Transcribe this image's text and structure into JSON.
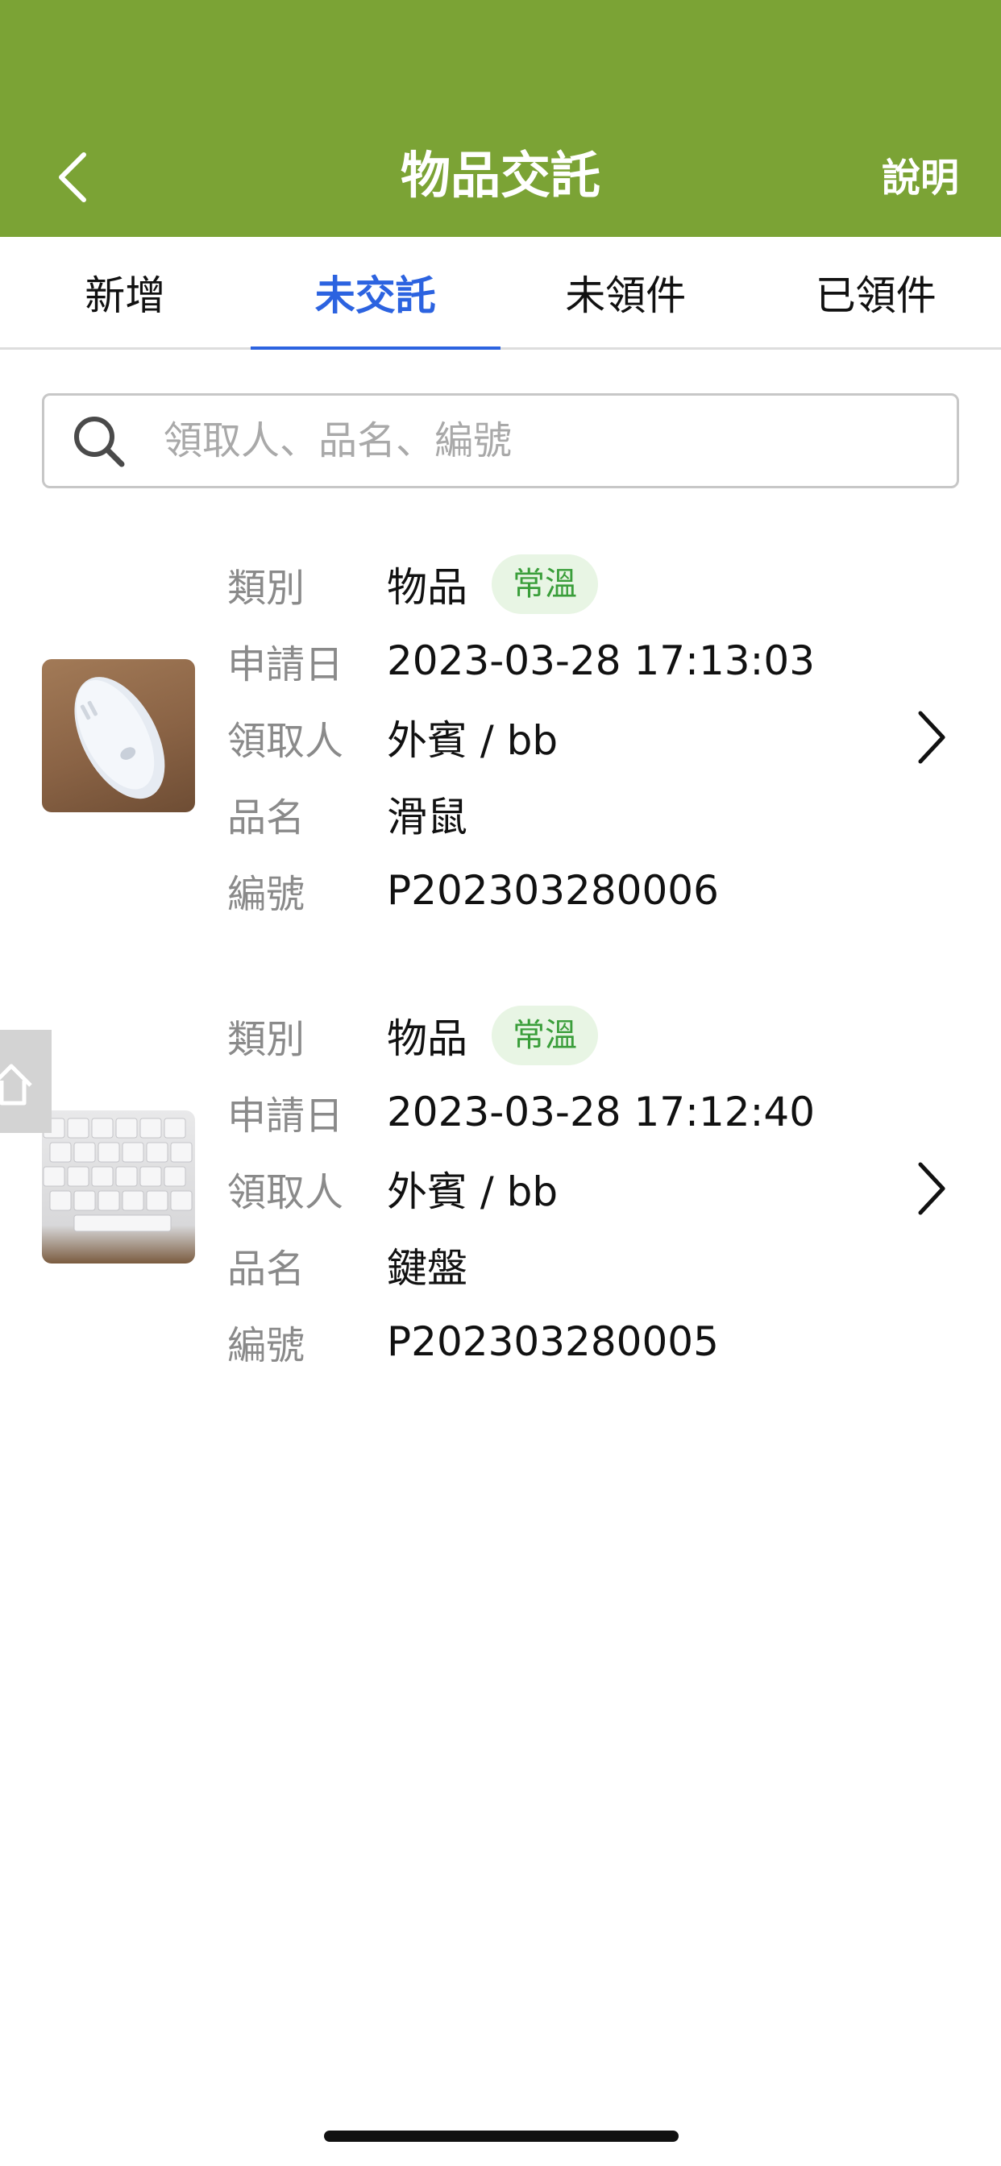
{
  "header": {
    "title": "物品交託",
    "help_label": "說明",
    "background_color": "#7ba335"
  },
  "tabs": [
    {
      "label": "新增",
      "active": false
    },
    {
      "label": "未交託",
      "active": true
    },
    {
      "label": "未領件",
      "active": false
    },
    {
      "label": "已領件",
      "active": false
    }
  ],
  "accent_color": "#2c63e0",
  "search": {
    "placeholder": "領取人、品名、編號",
    "value": "",
    "icon": "search-icon"
  },
  "items": [
    {
      "image": "mouse-photo",
      "category_label": "類別",
      "category": "物品",
      "temperature_badge": "常溫",
      "date_label": "申請日",
      "date": "2023-03-28 17:13:03",
      "recipient_label": "領取人",
      "recipient": "外賓 / bb",
      "name_label": "品名",
      "name": "滑鼠",
      "number_label": "編號",
      "number": "P202303280006"
    },
    {
      "image": "keyboard-photo",
      "category_label": "類別",
      "category": "物品",
      "temperature_badge": "常溫",
      "date_label": "申請日",
      "date": "2023-03-28 17:12:40",
      "recipient_label": "領取人",
      "recipient": "外賓 / bb",
      "name_label": "品名",
      "name": "鍵盤",
      "number_label": "編號",
      "number": "P202303280005"
    }
  ]
}
